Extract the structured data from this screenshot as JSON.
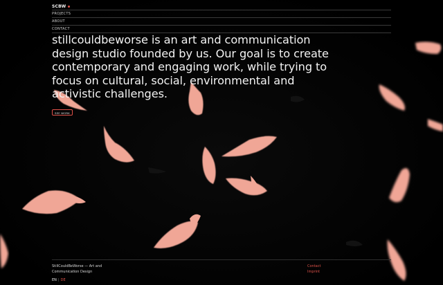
{
  "header": {
    "logo_text": "SCBW",
    "nav": [
      {
        "label": "PROJECTS"
      },
      {
        "label": "ABOUT"
      },
      {
        "label": "CONTACT"
      }
    ]
  },
  "main": {
    "intro_lines": [
      "stillcouldbeworse is an art and communication",
      "design studio founded by us. Our goal is to create",
      "contemporary and engaging work, while trying to",
      "focus on cultural, social, environmental and",
      "activistic challenges."
    ],
    "see_work_label": "SEE WORK"
  },
  "footer": {
    "studio_line1": "StillCouldBeWorse — Art and",
    "studio_line2": "Communication Design",
    "links": [
      {
        "label": "Contact"
      },
      {
        "label": "Imprint"
      }
    ],
    "lang_en": "EN",
    "lang_sep": "|",
    "lang_de": "DE"
  },
  "colors": {
    "background": "#000000",
    "text": "#f2f2f2",
    "accent": "#e0524a",
    "swan": "#f2a79a"
  }
}
